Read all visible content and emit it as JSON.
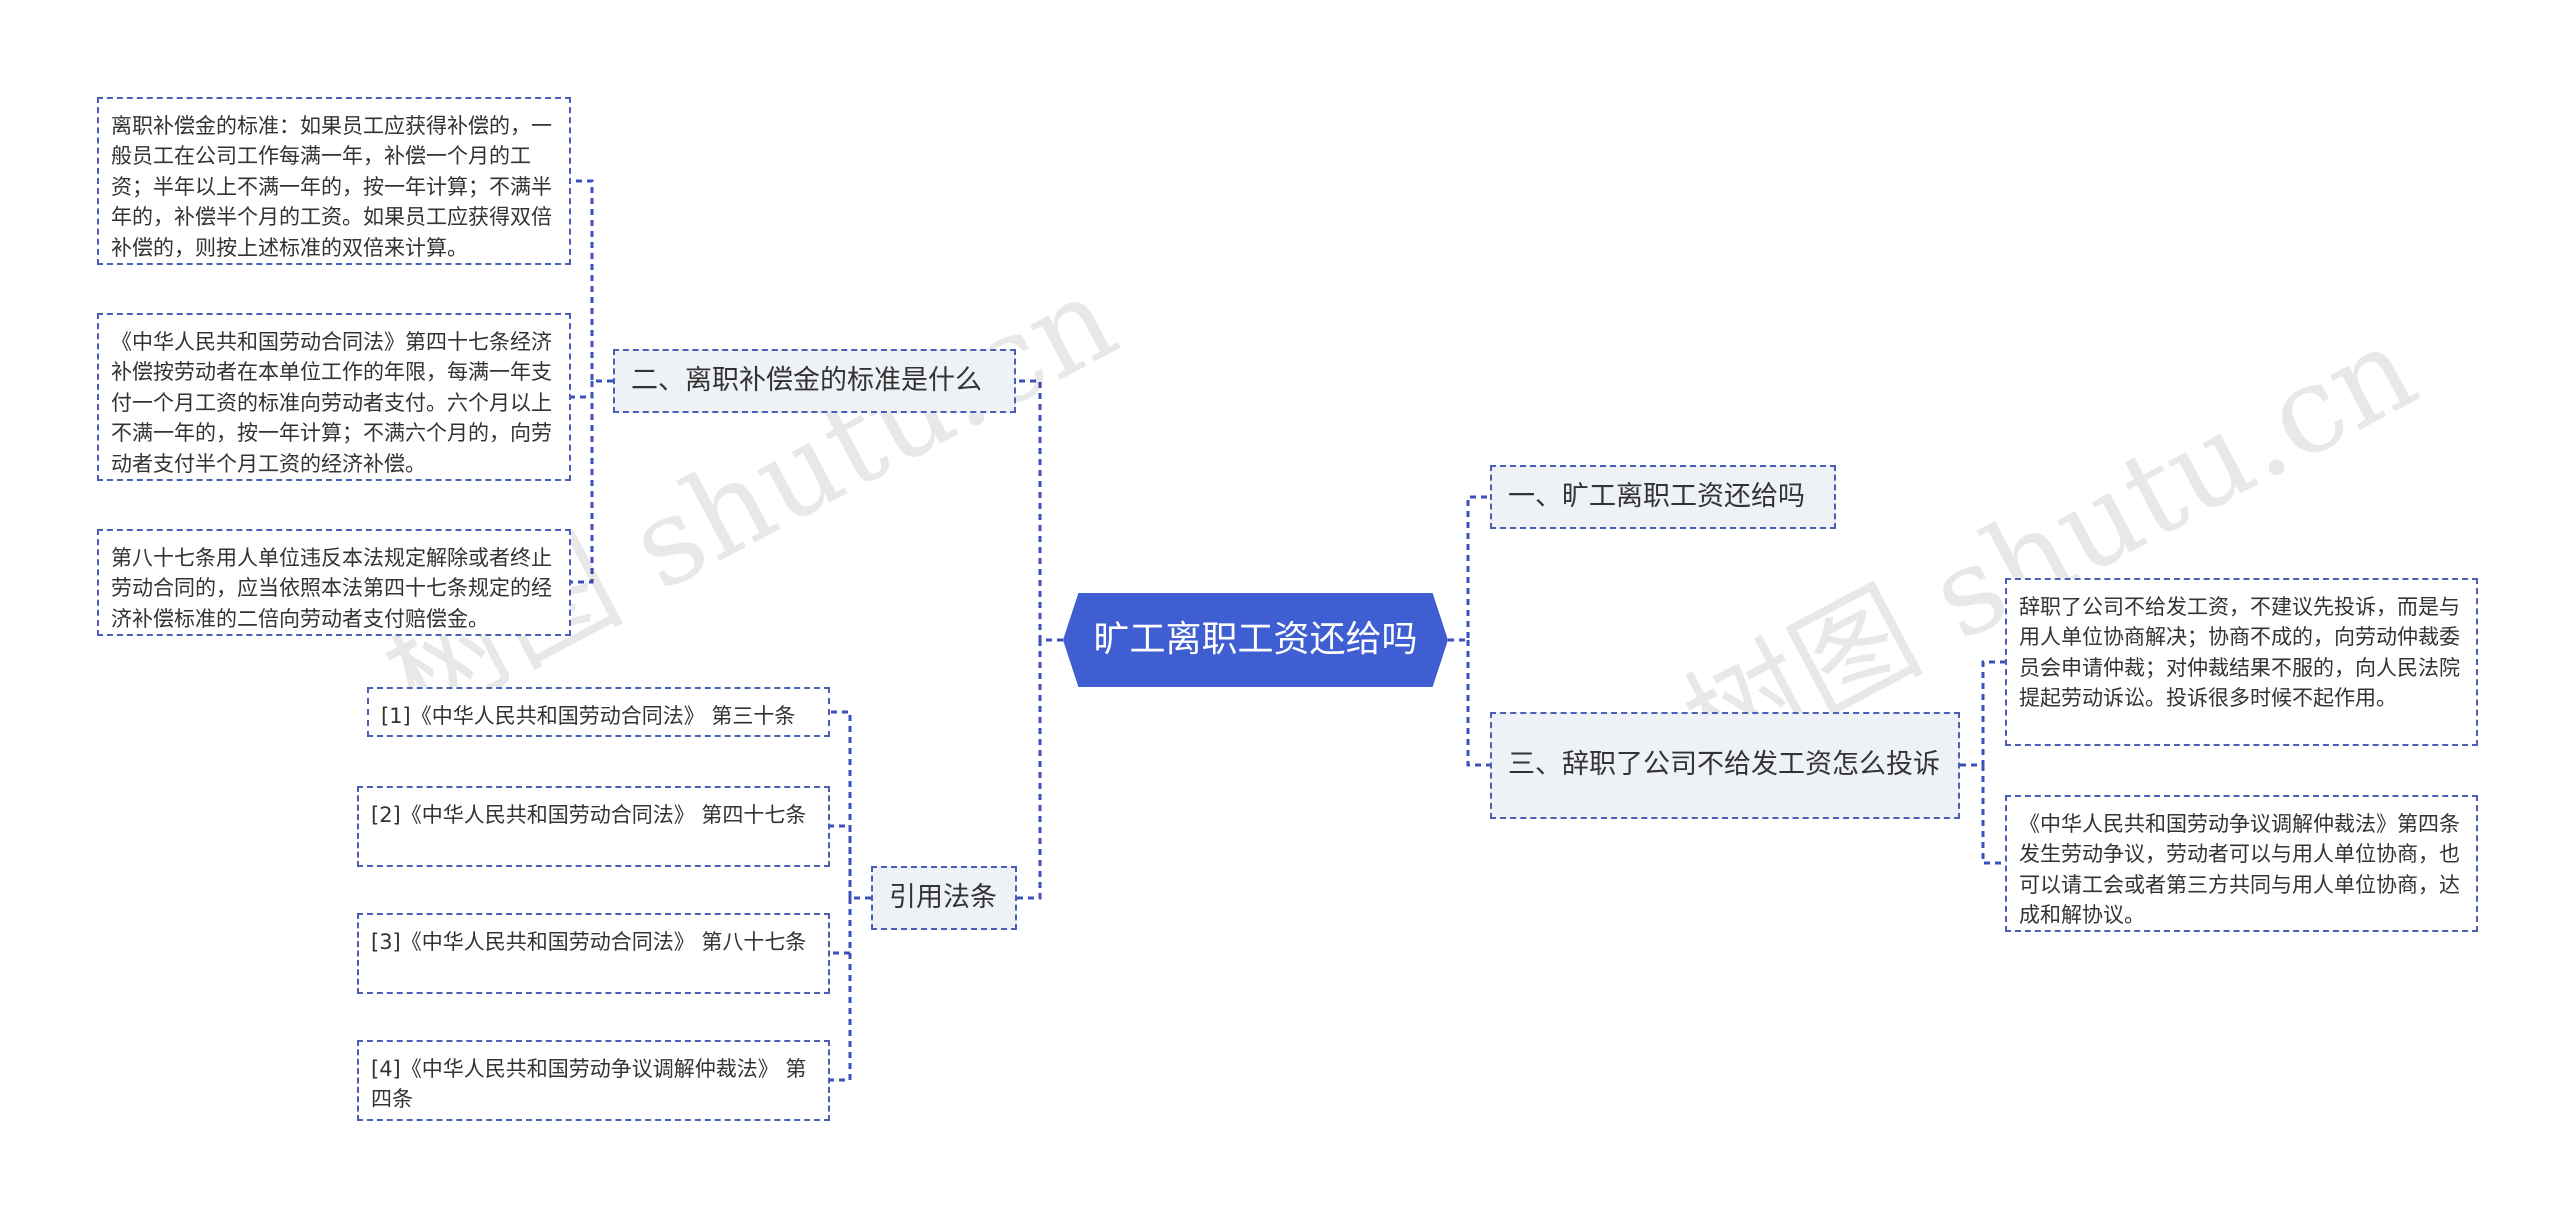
{
  "root": {
    "label": "旷工离职工资还给吗"
  },
  "topics": {
    "t1": {
      "label": "一、旷工离职工资还给吗"
    },
    "t2": {
      "label": "二、离职补偿金的标准是什么"
    },
    "t3": {
      "label": "三、辞职了公司不给发工资怎么投诉"
    },
    "t4": {
      "label": "引用法条"
    }
  },
  "leaves": {
    "t2": [
      "离职补偿金的标准：如果员工应获得补偿的，一般员工在公司工作每满一年，补偿一个月的工资；半年以上不满一年的，按一年计算；不满半年的，补偿半个月的工资。如果员工应获得双倍补偿的，则按上述标准的双倍来计算。",
      "《中华人民共和国劳动合同法》第四十七条经济补偿按劳动者在本单位工作的年限，每满一年支付一个月工资的标准向劳动者支付。六个月以上不满一年的，按一年计算；不满六个月的，向劳动者支付半个月工资的经济补偿。",
      "第八十七条用人单位违反本法规定解除或者终止劳动合同的，应当依照本法第四十七条规定的经济补偿标准的二倍向劳动者支付赔偿金。"
    ],
    "t4": [
      "[1]《中华人民共和国劳动合同法》 第三十条",
      "[2]《中华人民共和国劳动合同法》 第四十七条",
      "[3]《中华人民共和国劳动合同法》 第八十七条",
      "[4]《中华人民共和国劳动争议调解仲裁法》 第四条"
    ],
    "t3": [
      "辞职了公司不给发工资，不建议先投诉，而是与用人单位协商解决；协商不成的，向劳动仲裁委员会申请仲裁；对仲裁结果不服的，向人民法院提起劳动诉讼。投诉很多时候不起作用。",
      "《中华人民共和国劳动争议调解仲裁法》第四条发生劳动争议，劳动者可以与用人单位协商，也可以请工会或者第三方共同与用人单位协商，达成和解协议。"
    ]
  },
  "watermarks": [
    "树图 shutu.cn",
    "树图 shutu.cn"
  ],
  "colors": {
    "root_fill": "#3f5ed1",
    "connector": "#3b50b8",
    "topic_fill": "#eef1f5"
  }
}
